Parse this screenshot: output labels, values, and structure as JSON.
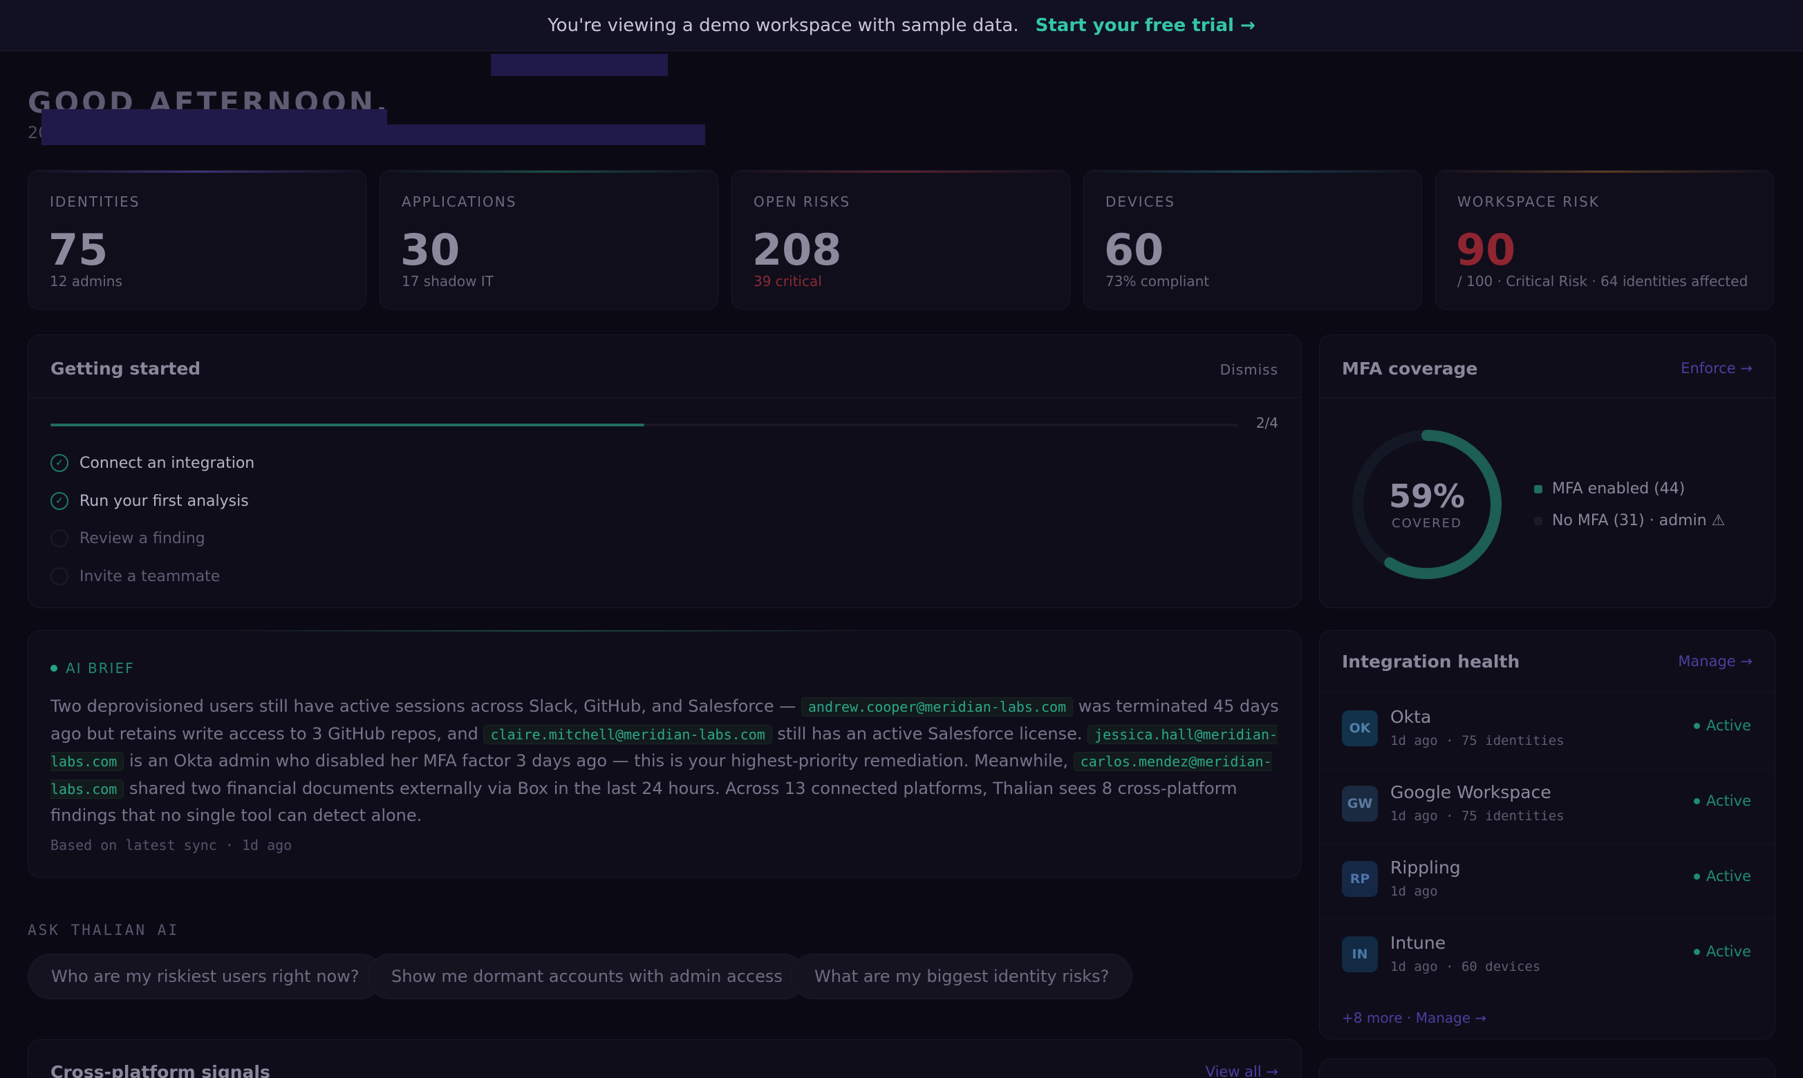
{
  "banner": {
    "message": "You're viewing a demo workspace with sample data.",
    "cta": "Start your free trial →"
  },
  "greeting": {
    "title": "GOOD AFTERNOON,",
    "date_prefix": "20"
  },
  "stats": [
    {
      "label": "IDENTITIES",
      "value": "75",
      "sub": "12 admins",
      "accent": "#3b3576",
      "sub_color": "#6a677c",
      "value_color": "#8c899c"
    },
    {
      "label": "APPLICATIONS",
      "value": "30",
      "sub": "17 shadow IT",
      "accent": "#1b4e43",
      "sub_color": "#6a677c",
      "value_color": "#8c899c"
    },
    {
      "label": "OPEN RISKS",
      "value": "208",
      "sub": "39 critical",
      "accent": "#5a2330",
      "sub_color": "#8a2a35",
      "value_color": "#8c899c"
    },
    {
      "label": "DEVICES",
      "value": "60",
      "sub": "73% compliant",
      "accent": "#1b4650",
      "sub_color": "#6a677c",
      "value_color": "#8c899c"
    },
    {
      "label": "WORKSPACE RISK",
      "value": "90",
      "sub": "/ 100 · Critical Risk · 64 identities affected",
      "accent": "#5a3a22",
      "sub_color": "#6a677c",
      "value_color": "#8f2530"
    }
  ],
  "getting_started": {
    "title": "Getting started",
    "dismiss": "Dismiss",
    "progress": 0.5,
    "count": "2/4",
    "steps": [
      {
        "label": "Connect an integration",
        "done": true
      },
      {
        "label": "Run your first analysis",
        "done": true
      },
      {
        "label": "Review a finding",
        "done": false
      },
      {
        "label": "Invite a teammate",
        "done": false
      }
    ]
  },
  "mfa": {
    "title": "MFA coverage",
    "enforce": "Enforce →",
    "percent_label": "59%",
    "percent": 0.59,
    "covered": "COVERED",
    "legend": [
      {
        "label": "MFA enabled (44)",
        "color": "#1f6e5f"
      },
      {
        "label": "No MFA (31) · admin ⚠",
        "color": "#1c1a2a"
      }
    ]
  },
  "ai_brief": {
    "tag": "AI BRIEF",
    "seg1": "Two deprovisioned users still have active sessions across Slack, GitHub, and Salesforce — ",
    "email1": "andrew.cooper@meridian-labs.com",
    "seg2": " was terminated 45 days ago but retains write access to 3 GitHub repos, and ",
    "email2": "claire.mitchell@meridian-labs.com",
    "seg3": " still has an active Salesforce license. ",
    "email3": "jessica.hall@meridian-labs.com",
    "seg4": " is an Okta admin who disabled her MFA factor 3 days ago — this is your highest-priority remediation. Meanwhile, ",
    "email4": "carlos.mendez@meridian-labs.com",
    "seg5": " shared two financial documents externally via Box in the last 24 hours. Across 13 connected platforms, Thalian sees 8 cross-platform findings that no single tool can detect alone.",
    "footer": "Based on latest sync · 1d ago"
  },
  "ask": {
    "label": "ASK THALIAN AI",
    "chips": [
      "Who are my riskiest users right now?",
      "Show me dormant accounts with admin access",
      "What are my biggest identity risks?"
    ]
  },
  "integrations": {
    "title": "Integration health",
    "manage": "Manage →",
    "items": [
      {
        "badge": "OK",
        "name": "Okta",
        "meta": "1d ago · 75 identities",
        "status": "Active",
        "badge_bg": "#12314a",
        "badge_fg": "#4d7fa8"
      },
      {
        "badge": "GW",
        "name": "Google Workspace",
        "meta": "1d ago · 75 identities",
        "status": "Active",
        "badge_bg": "#1a2a40",
        "badge_fg": "#5a7aa0"
      },
      {
        "badge": "RP",
        "name": "Rippling",
        "meta": "1d ago",
        "status": "Active",
        "badge_bg": "#152845",
        "badge_fg": "#4e75a8"
      },
      {
        "badge": "IN",
        "name": "Intune",
        "meta": "1d ago · 60 devices",
        "status": "Active",
        "badge_bg": "#122a44",
        "badge_fg": "#4b78a2"
      }
    ],
    "more": "+8 more · Manage →"
  },
  "signals": {
    "title": "Cross-platform signals",
    "view_all": "View all →"
  }
}
